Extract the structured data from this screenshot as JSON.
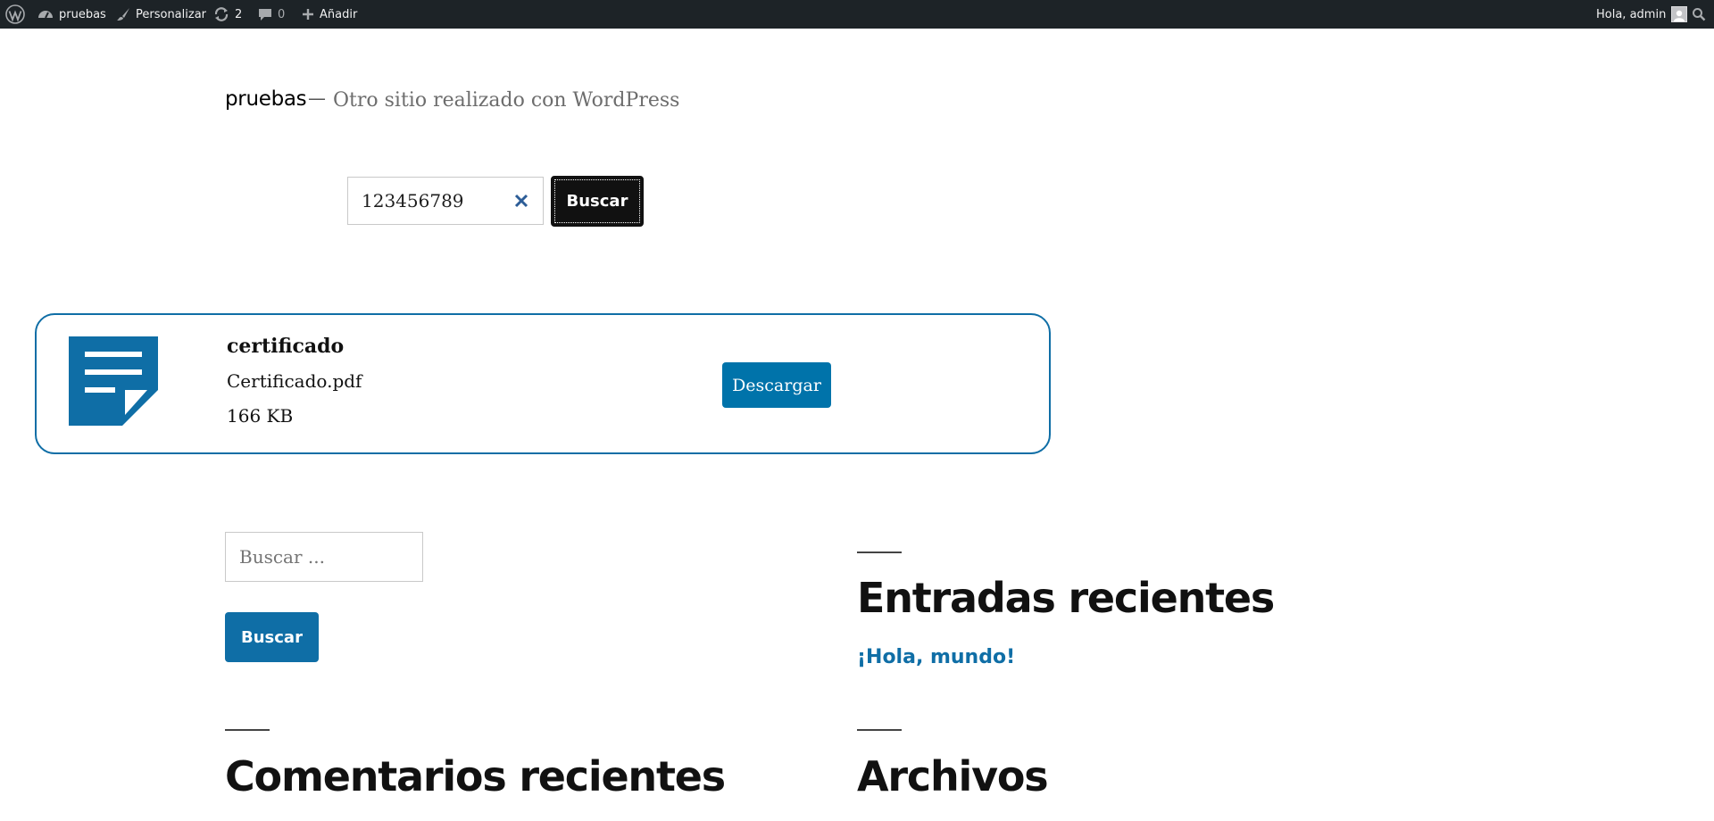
{
  "admin_bar": {
    "site_name": "pruebas",
    "customize_label": "Personalizar",
    "updates_count": "2",
    "comments_count": "0",
    "add_new_label": "Añadir",
    "greeting": "Hola, admin"
  },
  "site": {
    "title": "pruebas",
    "separator": "—",
    "description": "Otro sitio realizado con WordPress"
  },
  "search": {
    "value": "123456789",
    "button_label": "Buscar"
  },
  "result": {
    "name": "certificado",
    "filename": "Certificado.pdf",
    "size": "166 KB",
    "download_label": "Descargar"
  },
  "sidebar_search": {
    "placeholder": "Buscar ...",
    "button_label": "Buscar"
  },
  "widgets": {
    "recent_posts_title": "Entradas recientes",
    "recent_posts": [
      "¡Hola, mundo!"
    ],
    "recent_comments_title": "Comentarios recientes",
    "archives_title": "Archivos"
  },
  "colors": {
    "admin_bar_bg": "#1d2327",
    "accent_blue": "#0f6ea6",
    "dark_button": "#111111"
  },
  "icons": [
    "wordpress-logo-icon",
    "dashboard-icon",
    "brush-icon",
    "updates-icon",
    "comment-icon",
    "plus-icon",
    "avatar-icon",
    "search-icon",
    "clear-icon",
    "document-icon"
  ]
}
